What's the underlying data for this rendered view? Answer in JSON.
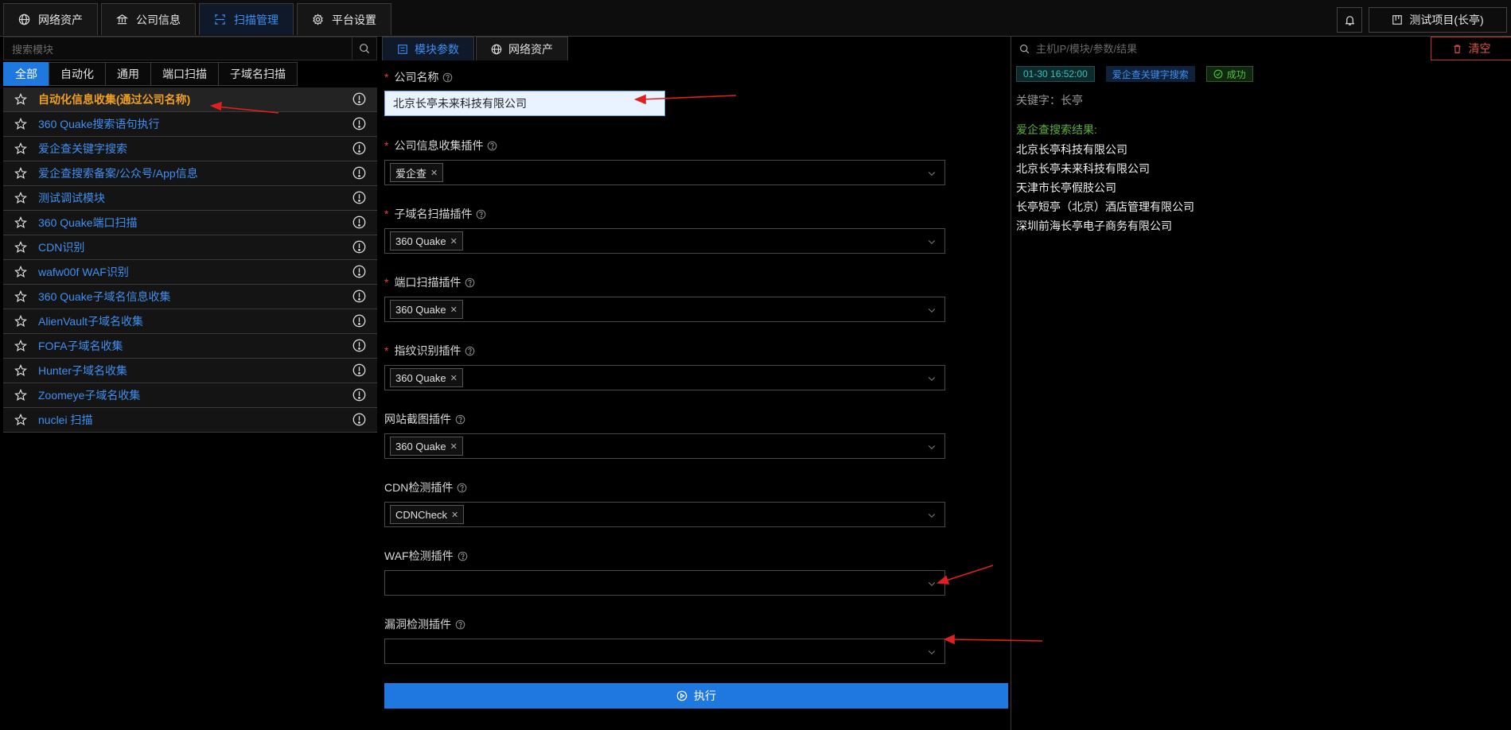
{
  "topnav": {
    "tabs": [
      {
        "label": "网络资产",
        "icon": "globe-icon"
      },
      {
        "label": "公司信息",
        "icon": "bank-icon"
      },
      {
        "label": "扫描管理",
        "icon": "scan-icon",
        "active": true
      },
      {
        "label": "平台设置",
        "icon": "gear-icon"
      }
    ],
    "project_label": "测试项目(长亭)"
  },
  "left": {
    "search_placeholder": "搜索模块",
    "filters": [
      "全部",
      "自动化",
      "通用",
      "端口扫描",
      "子域名扫描"
    ],
    "active_filter": "全部",
    "modules": [
      "自动化信息收集(通过公司名称)",
      "360 Quake搜索语句执行",
      "爱企查关键字搜索",
      "爱企查搜索备案/公众号/App信息",
      "测试调试模块",
      "360 Quake端口扫描",
      "CDN识别",
      "wafw00f WAF识别",
      "360 Quake子域名信息收集",
      "AlienVault子域名收集",
      "FOFA子域名收集",
      "Hunter子域名收集",
      "Zoomeye子域名收集",
      "nuclei 扫描"
    ],
    "selected_module": "自动化信息收集(通过公司名称)"
  },
  "middle": {
    "tabs": [
      "模块参数",
      "网络资产"
    ],
    "active_tab": "模块参数",
    "company_name": {
      "label": "公司名称",
      "value": "北京长亭未来科技有限公司"
    },
    "info_plugin": {
      "label": "公司信息收集插件",
      "tags": [
        "爱企查"
      ]
    },
    "subdomain_plugin": {
      "label": "子域名扫描插件",
      "tags": [
        "360 Quake"
      ]
    },
    "port_plugin": {
      "label": "端口扫描插件",
      "tags": [
        "360 Quake"
      ]
    },
    "fingerprint_plugin": {
      "label": "指纹识别插件",
      "tags": [
        "360 Quake"
      ]
    },
    "screenshot_plugin": {
      "label": "网站截图插件",
      "tags": [
        "360 Quake"
      ]
    },
    "cdn_plugin": {
      "label": "CDN检测插件",
      "tags": [
        "CDNCheck"
      ]
    },
    "waf_plugin": {
      "label": "WAF检测插件",
      "tags": []
    },
    "vuln_plugin": {
      "label": "漏洞检测插件",
      "tags": []
    },
    "run_label": "执行"
  },
  "right": {
    "search_placeholder": "主机IP/模块/参数/结果",
    "clear_label": "清空",
    "log": {
      "time": "01-30 16:52:00",
      "module": "爱企查关键字搜索",
      "status": "成功",
      "keyword_line": "关键字：长亭",
      "results_title": "爱企查搜索结果:",
      "results": [
        "北京长亭科技有限公司",
        "北京长亭未来科技有限公司",
        "天津市长亭假肢公司",
        "长亭短亭（北京）酒店管理有限公司",
        "深圳前海长亭电子商务有限公司"
      ]
    }
  },
  "colors": {
    "accent": "#1e78e0",
    "selected_module": "#f0a020",
    "danger": "#e05050",
    "success": "#4cc040",
    "annotation_arrow": "#e02020"
  }
}
